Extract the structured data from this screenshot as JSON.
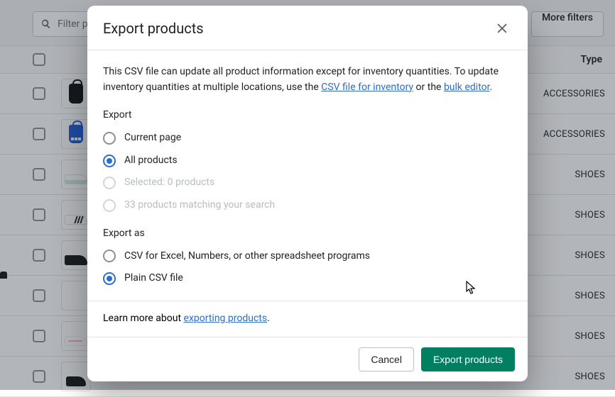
{
  "toolbar": {
    "filter_placeholder": "Filter products",
    "more_filters_label": "More filters"
  },
  "table": {
    "type_header": "Type",
    "rows": [
      {
        "thumb_class": "p-bag-black",
        "type": "ACCESSORIES"
      },
      {
        "thumb_class": "p-bag-blue",
        "type": "ACCESSORIES"
      },
      {
        "thumb_class": "p-shoe p-shoe-whitegrn",
        "type": "SHOES"
      },
      {
        "thumb_class": "p-shoe p-shoe-whitestripe",
        "type": "SHOES"
      },
      {
        "thumb_class": "p-shoe p-shoe-blacklow",
        "type": "SHOES"
      },
      {
        "thumb_class": "p-shoe-blackhi",
        "type": "SHOES"
      },
      {
        "thumb_class": "p-shoe p-shoe-whitepink",
        "type": "SHOES"
      },
      {
        "thumb_class": "p-shoe p-shoe-blacksm",
        "type": "SHOES"
      }
    ]
  },
  "modal": {
    "title": "Export products",
    "description_prefix": "This CSV file can update all product information except for inventory quantities. To update inventory quantities at multiple locations, use the ",
    "link_csv_inventory": "CSV file for inventory",
    "description_mid": " or the ",
    "link_bulk_editor": "bulk editor",
    "description_suffix": ".",
    "export_section_label": "Export",
    "export_options": {
      "current_page": "Current page",
      "all_products": "All products",
      "selected": "Selected: 0 products",
      "matching": "33 products matching your search"
    },
    "export_as_label": "Export as",
    "export_as_options": {
      "csv_excel": "CSV for Excel, Numbers, or other spreadsheet programs",
      "plain_csv": "Plain CSV file"
    },
    "learn_more_prefix": "Learn more about ",
    "learn_more_link": "exporting products",
    "learn_more_suffix": ".",
    "cancel_label": "Cancel",
    "export_button_label": "Export products"
  }
}
